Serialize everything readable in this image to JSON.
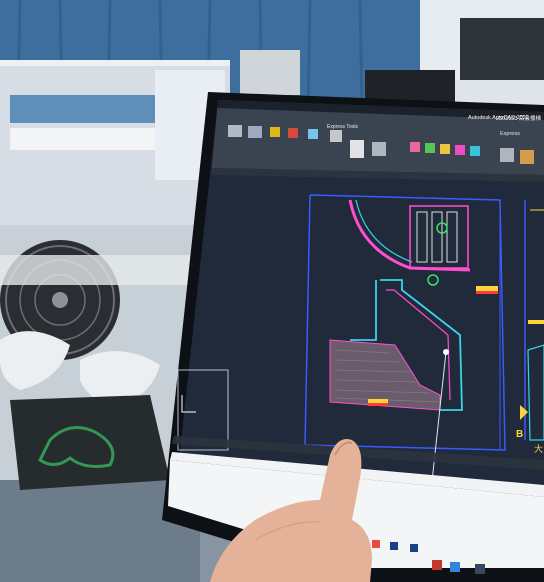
{
  "photo": {
    "subject": "office-desk-with-autocad-monitor"
  },
  "app": {
    "title": "Autodesk AutoCAD 2022",
    "file_name": "2303153 后会楼梯",
    "ribbon_tab_visible": "Express",
    "ribbon_tab_express_tools": "Express Tools"
  },
  "drawing": {
    "view_marker_letter": "B",
    "view_marker_char": "大"
  },
  "colors": {
    "wall": "#a6b4c2",
    "screen_bg": "#202a3a",
    "ribbon": "#3a4350",
    "cad_cyan": "#39d3e8",
    "cad_magenta": "#ff4fd0",
    "cad_yellow": "#ffd43b",
    "cad_red": "#ff3b3b",
    "cad_green": "#37e36a",
    "desk": "#cfd6de"
  }
}
